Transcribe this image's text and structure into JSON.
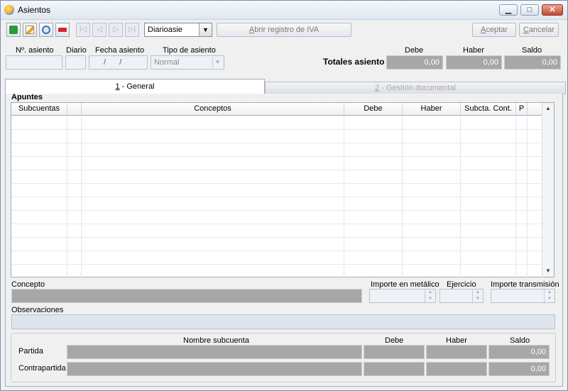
{
  "window": {
    "title": "Asientos",
    "controls": [
      "minimize-icon",
      "maximize-icon",
      "close-icon"
    ]
  },
  "toolbar": {
    "icons": [
      "add-icon",
      "edit-icon",
      "search-icon",
      "delete-icon"
    ],
    "nav_icons": [
      "first-icon",
      "prev-icon",
      "next-icon",
      "last-icon"
    ],
    "diario_select": "Diarioasie",
    "iva_button": "Abrir registro de IVA",
    "iva_accel": "A",
    "iva_rest": "brir registro de IVA",
    "ok_accel": "A",
    "ok_rest": "ceptar",
    "cancel_accel": "C",
    "cancel_rest": "ancelar"
  },
  "header": {
    "num_asiento_label": "Nº. asiento",
    "diario_label": "Diario",
    "fecha_label": "Fecha asiento",
    "fecha_value": "/ /",
    "tipo_label": "Tipo de asiento",
    "tipo_value": "Normal",
    "totales_label": "Totales asiento",
    "debe_label": "Debe",
    "haber_label": "Haber",
    "saldo_label": "Saldo",
    "debe_value": "0,00",
    "haber_value": "0,00",
    "saldo_value": "0,00"
  },
  "tabs": {
    "general_accel": "1",
    "general_rest": " - General",
    "gestion_accel": "2",
    "gestion_rest": " - Gestión documental"
  },
  "apuntes": {
    "title": "Apuntes",
    "columns": [
      "Subcuentas",
      "",
      "Conceptos",
      "Debe",
      "Haber",
      "Subcta. Cont.",
      "P",
      ""
    ]
  },
  "detail": {
    "concepto_label": "Concepto",
    "importe_metalico_label": "Importe en metálico",
    "ejercicio_label": "Ejercicio",
    "importe_transmision_label": "Importe transmisión",
    "observaciones_label": "Observaciones"
  },
  "summary": {
    "nombre_label": "Nombre subcuenta",
    "debe_label": "Debe",
    "haber_label": "Haber",
    "saldo_label": "Saldo",
    "partida_label": "Partida",
    "contrapartida_label": "Contrapartida",
    "partida_saldo": "0,00",
    "contrapartida_saldo": "0,00"
  }
}
